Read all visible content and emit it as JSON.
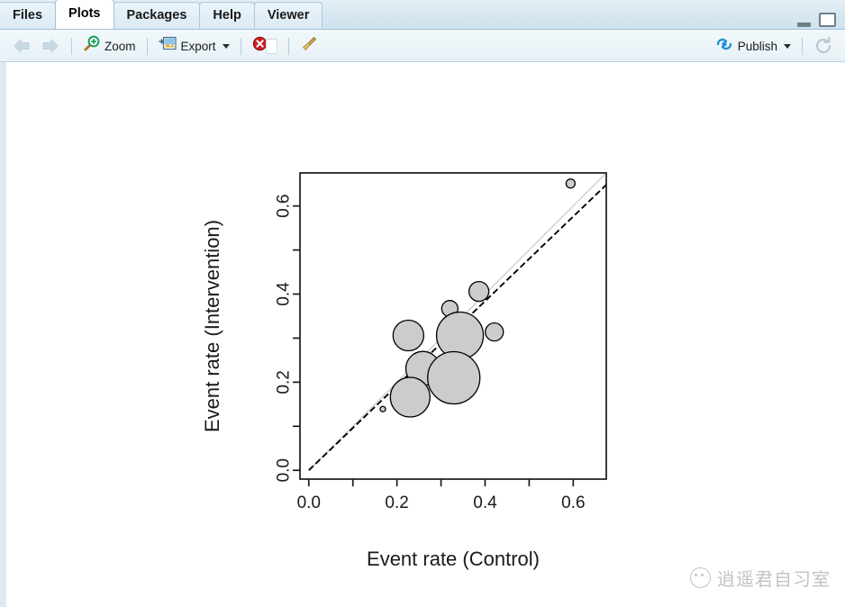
{
  "window": {
    "minimize_label": "minimize",
    "maximize_label": "maximize"
  },
  "tabs": [
    {
      "label": "Files",
      "active": false,
      "name": "tab-files"
    },
    {
      "label": "Plots",
      "active": true,
      "name": "tab-plots"
    },
    {
      "label": "Packages",
      "active": false,
      "name": "tab-packages"
    },
    {
      "label": "Help",
      "active": false,
      "name": "tab-help"
    },
    {
      "label": "Viewer",
      "active": false,
      "name": "tab-viewer"
    }
  ],
  "toolbar": {
    "back_label": "Back",
    "forward_label": "Forward",
    "zoom_label": "Zoom",
    "export_label": "Export",
    "remove_label": "Remove current plot",
    "clear_label": "Clear all plots",
    "publish_label": "Publish",
    "refresh_label": "Refresh current plot"
  },
  "watermark": {
    "text": "逍遥君自习室"
  },
  "chart_data": {
    "type": "scatter",
    "title": "",
    "xlabel": "Event rate (Control)",
    "ylabel": "Event rate (Intervention)",
    "xlim": [
      -0.02,
      0.675
    ],
    "ylim": [
      -0.02,
      0.675
    ],
    "xticks": [
      0.0,
      0.1,
      0.2,
      0.3,
      0.4,
      0.5,
      0.6
    ],
    "yticks": [
      0.0,
      0.1,
      0.2,
      0.3,
      0.4,
      0.5,
      0.6
    ],
    "xtick_labels": [
      "0.0",
      "",
      "0.2",
      "",
      "0.4",
      "",
      "0.6"
    ],
    "ytick_labels": [
      "0.0",
      "",
      "0.2",
      "",
      "0.4",
      "",
      "0.6"
    ],
    "grid": false,
    "legend": "none",
    "point_fill": "#cccccc",
    "point_stroke": "#000000",
    "reference_line": {
      "name": "identity-line",
      "style": "solid",
      "color": "#bfbfbf",
      "from": [
        0.0,
        0.0
      ],
      "to": [
        0.675,
        0.675
      ]
    },
    "fit_line": {
      "name": "regression-line",
      "style": "dashed",
      "color": "#000000",
      "from": [
        0.0,
        0.0
      ],
      "to": [
        0.675,
        0.648
      ]
    },
    "size_encoding": "bubble area = study weight / precision",
    "points": [
      {
        "x": 0.226,
        "y": 0.306,
        "r": 17
      },
      {
        "x": 0.32,
        "y": 0.367,
        "r": 9
      },
      {
        "x": 0.386,
        "y": 0.406,
        "r": 11
      },
      {
        "x": 0.421,
        "y": 0.314,
        "r": 10
      },
      {
        "x": 0.343,
        "y": 0.306,
        "r": 26
      },
      {
        "x": 0.259,
        "y": 0.231,
        "r": 19
      },
      {
        "x": 0.329,
        "y": 0.21,
        "r": 29
      },
      {
        "x": 0.23,
        "y": 0.166,
        "r": 22
      },
      {
        "x": 0.168,
        "y": 0.139,
        "r": 3
      },
      {
        "x": 0.594,
        "y": 0.651,
        "r": 5
      }
    ]
  }
}
